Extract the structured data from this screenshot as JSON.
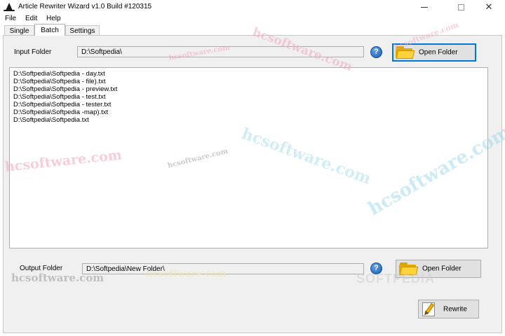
{
  "window": {
    "title": "Article Rewriter Wizard v1.0 Build #120315",
    "minimize_icon": "minimize-icon",
    "maximize_icon": "maximize-icon",
    "close_icon": "close-icon",
    "close_glyph": "✕"
  },
  "menu": [
    "File",
    "Edit",
    "Help"
  ],
  "tabs": [
    {
      "label": "Single",
      "active": false
    },
    {
      "label": "Batch",
      "active": true
    },
    {
      "label": "Settings",
      "active": false
    }
  ],
  "input_folder": {
    "label": "Input Folder",
    "value": "D:\\Softpedia\\",
    "help_glyph": "?",
    "button_label": "Open Folder",
    "icon": "folder-icon"
  },
  "files": [
    "D:\\Softpedia\\Softpedia - day.txt",
    "D:\\Softpedia\\Softpedia - file).txt",
    "D:\\Softpedia\\Softpedia - preview.txt",
    "D:\\Softpedia\\Softpedia - test.txt",
    "D:\\Softpedia\\Softpedia - tester.txt",
    "D:\\Softpedia\\Softpedia -map).txt",
    "D:\\Softpedia\\Softpedia.txt"
  ],
  "output_folder": {
    "label": "Output Folder",
    "value": "D:\\Softpedia\\New Folder\\",
    "help_glyph": "?",
    "button_label": "Open Folder",
    "icon": "folder-icon"
  },
  "rewrite_button": {
    "label": "Rewrite",
    "icon": "pencil-icon"
  },
  "watermarks": {
    "hcsoftware": "hcsoftware.com",
    "softpedia": "SOFTPEDIA"
  },
  "colors": {
    "focus_border": "#0078d7",
    "help_icon": "#1d5fb4",
    "folder": "#ffd23c",
    "watermark_pink": "#f2a6bd",
    "watermark_cyan": "#9ad8ec",
    "watermark_gray": "#a0a0a0"
  }
}
